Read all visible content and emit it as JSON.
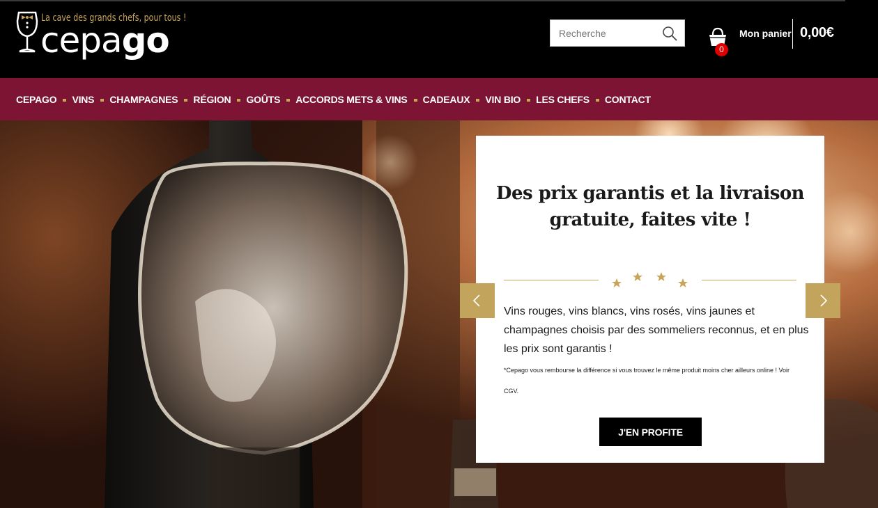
{
  "header": {
    "logo": {
      "tagline": "La cave des grands chefs, pour tous !",
      "word_light": "cepa",
      "word_bold": "go"
    },
    "search": {
      "placeholder": "Recherche",
      "icon": "search-icon"
    },
    "cart": {
      "count": "0",
      "label": "Mon panier",
      "total": "0,00€",
      "icon": "basket-icon"
    }
  },
  "nav": {
    "items": [
      "CEPAGO",
      "VINS",
      "CHAMPAGNES",
      "RÉGION",
      "GOÛTS",
      "ACCORDS METS & VINS",
      "CADEAUX",
      "VIN BIO",
      "LES CHEFS",
      "CONTACT"
    ]
  },
  "hero": {
    "title": "Des prix garantis et la livraison gratuite, faites vite !",
    "body": "Vins rouges, vins blancs, vins rosés, vins jaunes et champagnes choisis par des sommeliers reconnus, et en plus les prix sont garantis !",
    "note": "*Cepago vous rembourse la différence si vous trouvez le même produit moins cher ailleurs online ! Voir CGV.",
    "cta": "J'EN PROFITE",
    "prev_icon": "chevron-left-icon",
    "next_icon": "chevron-right-icon"
  },
  "colors": {
    "nav_bg": "#7d1433",
    "gold": "#c9a55b",
    "arrow_bg": "#c3a45c",
    "badge": "#e00000"
  }
}
